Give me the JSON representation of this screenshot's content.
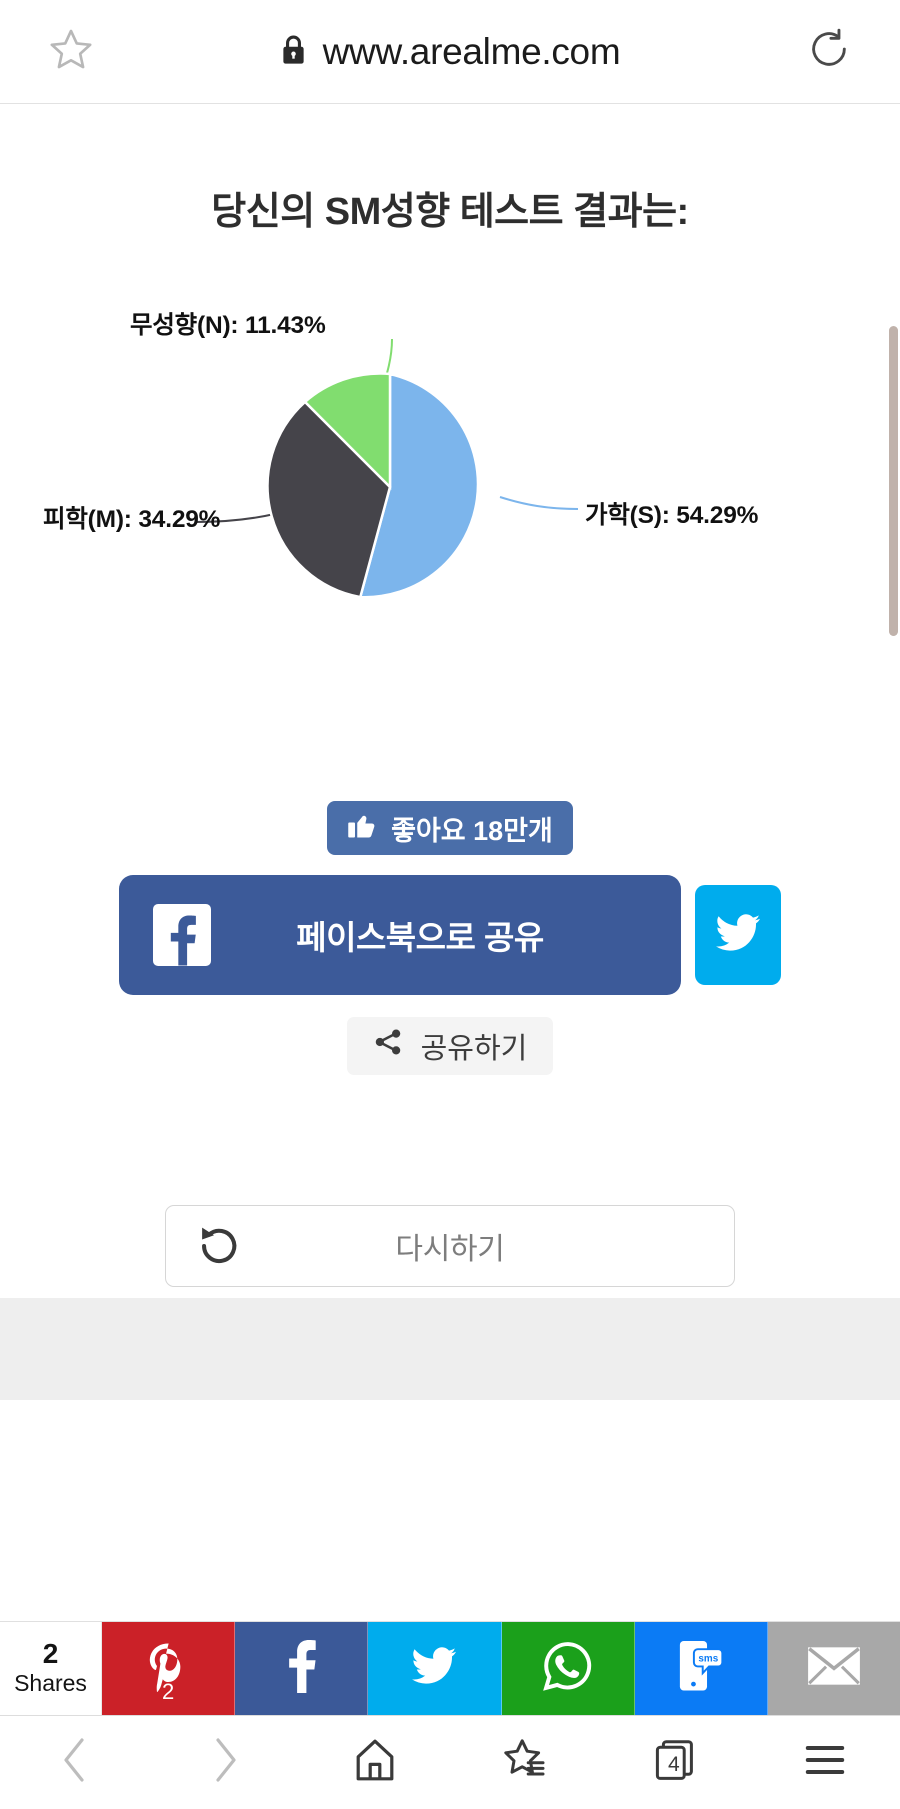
{
  "browser": {
    "url": "www.arealme.com",
    "lock_icon": "lock-icon",
    "star_icon": "star-outline-icon",
    "reload_icon": "reload-icon",
    "bottom_nav": {
      "back": "chevron-left-icon",
      "forward": "chevron-right-icon",
      "home": "home-icon",
      "bookmarks": "bookmark-star-icon",
      "tabs_icon": "tabs-icon",
      "tabs_count": "4",
      "menu": "hamburger-menu-icon"
    }
  },
  "page": {
    "title": "당신의 SM성향 테스트 결과는:",
    "like_button": {
      "label": "좋아요 18만개",
      "icon": "thumbs-up-icon",
      "color": "#4a6ea9"
    },
    "facebook_share": {
      "label": "페이스북으로 공유",
      "icon": "facebook-icon",
      "color": "#3c5a99"
    },
    "twitter_share": {
      "icon": "twitter-bird-icon",
      "color": "#00aced"
    },
    "share_chip": {
      "label": "공유하기",
      "icon": "share-nodes-icon"
    },
    "retry_button": {
      "label": "다시하기",
      "icon": "rotate-left-icon"
    }
  },
  "chart_data": {
    "type": "pie",
    "title": "당신의 SM성향 테스트 결과는:",
    "categories": [
      "가학(S)",
      "피학(M)",
      "무성향(N)"
    ],
    "values": [
      54.29,
      34.29,
      11.43
    ],
    "labels": [
      "가학(S): 54.29%",
      "피학(M): 34.29%",
      "무성향(N): 11.43%"
    ],
    "colors": [
      "#7cb5ec",
      "#45444a",
      "#81dd6f"
    ],
    "legend": "none",
    "start_angle_deg": 0,
    "direction": "clockwise",
    "units": "%"
  },
  "sharebar": {
    "count": "2",
    "count_label": "Shares",
    "items": [
      {
        "name": "pinterest",
        "icon": "pinterest-icon",
        "color": "#cb2128",
        "badge": "2"
      },
      {
        "name": "facebook",
        "icon": "facebook-icon",
        "color": "#3b5998",
        "badge": ""
      },
      {
        "name": "twitter",
        "icon": "twitter-bird-icon",
        "color": "#00aced",
        "badge": ""
      },
      {
        "name": "whatsapp",
        "icon": "whatsapp-icon",
        "color": "#1ba01b",
        "badge": ""
      },
      {
        "name": "sms",
        "icon": "sms-icon",
        "color": "#0b7bf5",
        "badge": ""
      },
      {
        "name": "email",
        "icon": "envelope-icon",
        "color": "#a8a8a8",
        "badge": ""
      }
    ]
  }
}
